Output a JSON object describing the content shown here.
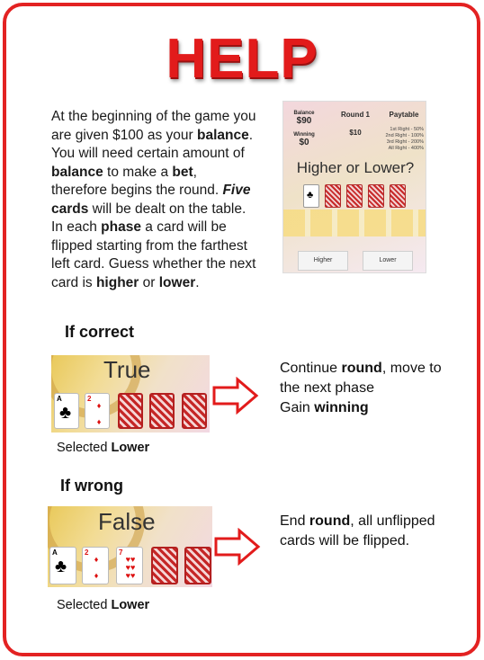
{
  "title": "HELP",
  "intro": {
    "t1": "At the beginning of the game you are given $100 as your ",
    "b1": "balance",
    "t2": ". You will need certain amount of ",
    "b2": "balance",
    "t3": " to make a ",
    "b3": "bet",
    "t4": ", therefore begins the round. ",
    "b4a": "Five",
    "b4b": " cards",
    "t5": " will be dealt on the table. In each ",
    "b5": "phase",
    "t6": " a card will be flipped starting from the farthest left card. Guess whether the next card is ",
    "b6": "higher",
    "t7": " or ",
    "b7": "lower",
    "t8": "."
  },
  "preview": {
    "balance_label": "Balance",
    "balance_value": "$90",
    "round_label": "Round 1",
    "paytable_label": "Paytable",
    "winning_label": "Winning",
    "winning_value": "$0",
    "bet_value": "$10",
    "paytable": [
      "1st Right - 50%",
      "2nd Right - 100%",
      "3rd Right - 200%",
      "All Right - 400%"
    ],
    "prompt": "Higher or Lower?",
    "higher_button": "Higher",
    "lower_button": "Lower"
  },
  "correct": {
    "heading": "If correct",
    "result": "True",
    "caption_pre": "Selected ",
    "caption_bold": "Lower",
    "d1a": "Continue ",
    "d1b": "round",
    "d1c": ", move to",
    "d2": "the next phase",
    "d3a": "Gain ",
    "d3b": "winning"
  },
  "wrong": {
    "heading": "If wrong",
    "result": "False",
    "caption_pre": "Selected ",
    "caption_bold": "Lower",
    "d1a": "End ",
    "d1b": "round",
    "d1c": ", all unflipped",
    "d2": "cards will be flipped."
  },
  "colors": {
    "accent": "#e21b1b",
    "border": "#e32222",
    "card_back": "#c52626"
  },
  "icons": {
    "arrow": "right-outline-arrow-icon",
    "club": "club-suit-icon",
    "diamond": "diamond-suit-icon",
    "heart": "heart-suit-icon"
  }
}
